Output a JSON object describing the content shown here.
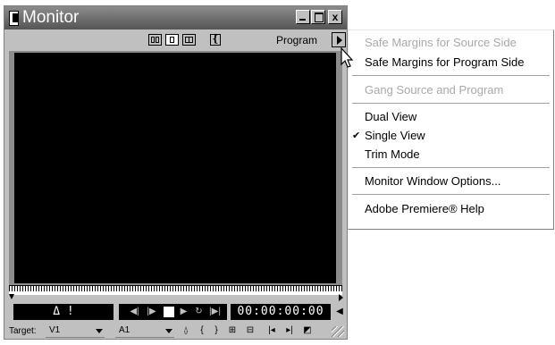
{
  "window": {
    "title": "Monitor",
    "title_buttons": {
      "minimize": "_",
      "maximize": "□",
      "close": "x"
    }
  },
  "toolbar": {
    "view_buttons": [
      "dual-view-icon",
      "single-view-icon",
      "trim-mode-icon",
      "edit-line-icon"
    ],
    "program_label": "Program",
    "menu_arrow_icon": "triangle-right-icon"
  },
  "controls": {
    "delta_readout": "Δ !",
    "timecode": "00:00:00:00",
    "transport_icons": [
      "step-back-icon",
      "step-forward-icon",
      "stop-icon",
      "play-icon",
      "loop-icon",
      "play-in-to-out-icon"
    ],
    "volume_icon": "speaker-icon"
  },
  "target": {
    "label": "Target:",
    "video_value": "V1",
    "audio_value": "A1",
    "edit_icons": [
      "lift-icon",
      "mark-in-icon",
      "mark-out-icon",
      "insert-icon",
      "overlay-icon",
      "go-to-in-icon",
      "go-to-out-icon",
      "clear-icon"
    ]
  },
  "menu": {
    "items": [
      {
        "label": "Safe Margins for Source Side",
        "enabled": false
      },
      {
        "label": "Safe Margins for Program Side",
        "enabled": true
      },
      {
        "label": "Gang Source and Program",
        "enabled": false
      },
      {
        "label": "Dual View",
        "enabled": true
      },
      {
        "label": "Single View",
        "enabled": true,
        "checked": true
      },
      {
        "label": "Trim Mode",
        "enabled": true
      },
      {
        "label": "Monitor Window Options...",
        "enabled": true
      },
      {
        "label": "Adobe Premiere® Help",
        "enabled": true
      }
    ],
    "check_mark": "✔"
  },
  "colors": {
    "titlebar": "#555555",
    "panel": "#c0c0c0",
    "screen": "#000000",
    "menu_bg": "#ffffff",
    "disabled_text": "#a9a9a9"
  }
}
